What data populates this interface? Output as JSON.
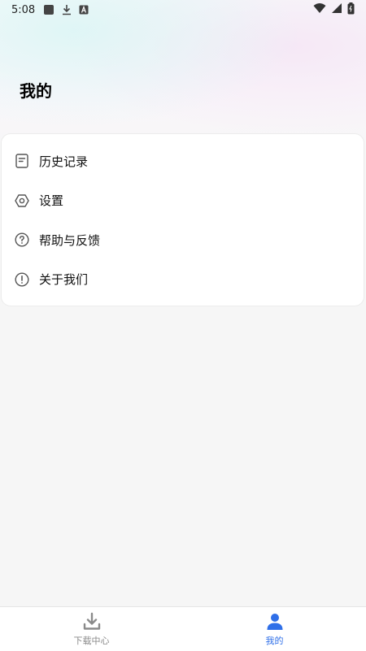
{
  "status_bar": {
    "time": "5:08",
    "icons": [
      "app-square-icon",
      "download-icon",
      "a-box-icon",
      "wifi-icon",
      "signal-icon",
      "battery-icon"
    ]
  },
  "page": {
    "title": "我的"
  },
  "menu": {
    "items": [
      {
        "label": "历史记录",
        "icon": "history-doc-icon"
      },
      {
        "label": "设置",
        "icon": "settings-hex-icon"
      },
      {
        "label": "帮助与反馈",
        "icon": "help-circle-icon"
      },
      {
        "label": "关于我们",
        "icon": "info-circle-icon"
      }
    ]
  },
  "bottom_nav": {
    "tabs": [
      {
        "label": "下载中心",
        "icon": "download-tray-icon",
        "active": false
      },
      {
        "label": "我的",
        "icon": "user-icon",
        "active": true
      }
    ]
  },
  "colors": {
    "accent": "#2f6fe8",
    "inactive": "#8a8a8a",
    "background": "#f6f6f6",
    "card": "#ffffff"
  }
}
